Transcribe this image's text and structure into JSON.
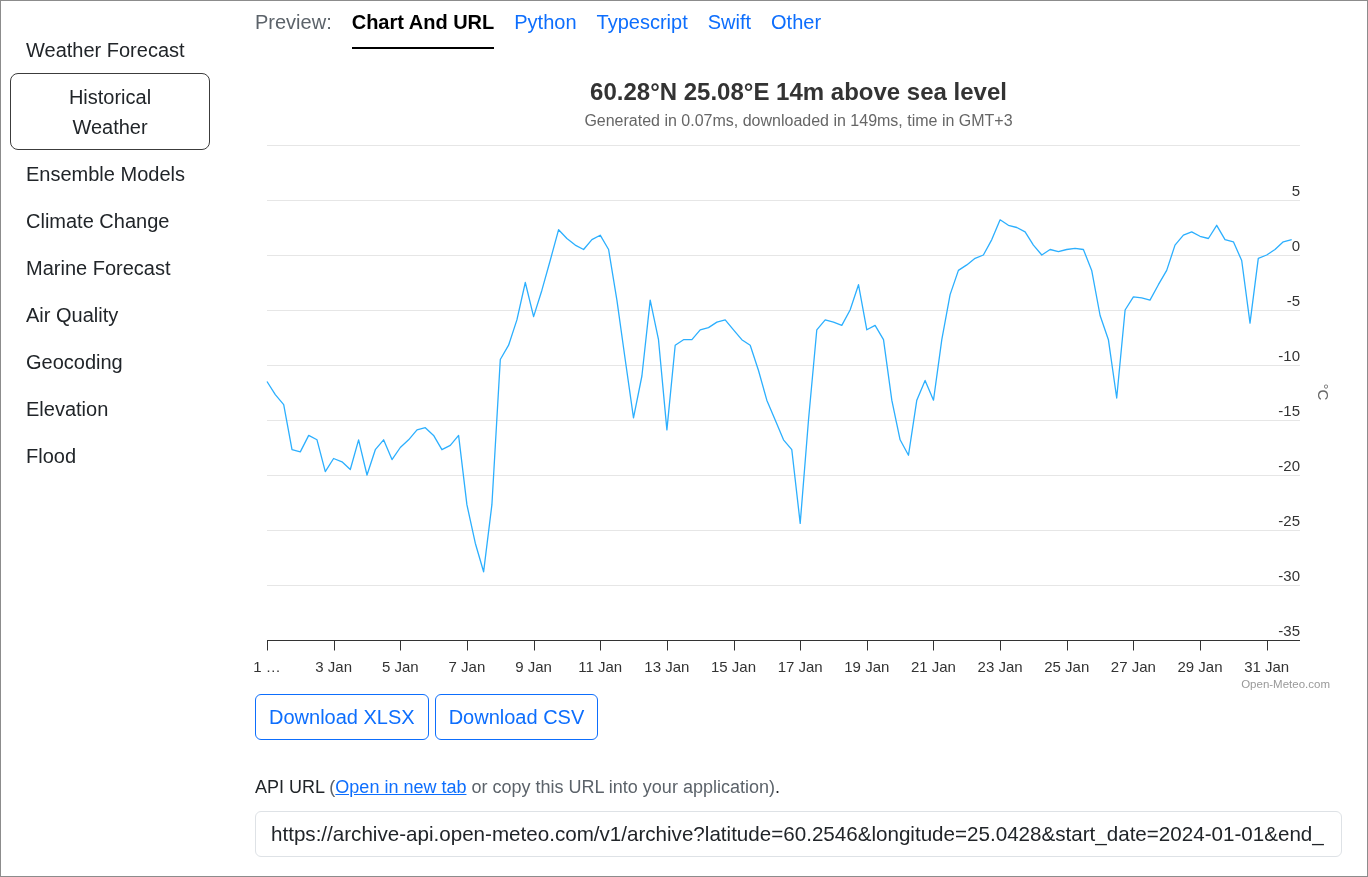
{
  "sidebar": {
    "items": [
      {
        "label": "Weather Forecast",
        "selected": false
      },
      {
        "label": "Historical Weather",
        "selected": true
      },
      {
        "label": "Ensemble Models",
        "selected": false
      },
      {
        "label": "Climate Change",
        "selected": false
      },
      {
        "label": "Marine Forecast",
        "selected": false
      },
      {
        "label": "Air Quality",
        "selected": false
      },
      {
        "label": "Geocoding",
        "selected": false
      },
      {
        "label": "Elevation",
        "selected": false
      },
      {
        "label": "Flood",
        "selected": false
      }
    ]
  },
  "preview_tabs": {
    "label": "Preview:",
    "tabs": [
      {
        "label": "Chart And URL",
        "selected": true
      },
      {
        "label": "Python",
        "selected": false
      },
      {
        "label": "Typescript",
        "selected": false
      },
      {
        "label": "Swift",
        "selected": false
      },
      {
        "label": "Other",
        "selected": false
      }
    ]
  },
  "chart": {
    "subtitle": "Generated in 0.07ms, downloaded in 149ms, time in GMT+3",
    "credit": "Open-Meteo.com",
    "chart_data": {
      "type": "line",
      "title": "60.28°N 25.08°E 14m above sea level",
      "ylabel": "°C",
      "grid": true,
      "categories": [
        "1 …",
        null,
        null,
        null,
        null,
        null,
        null,
        null,
        "3 Jan",
        null,
        null,
        null,
        null,
        null,
        null,
        null,
        "5 Jan",
        null,
        null,
        null,
        null,
        null,
        null,
        null,
        "7 Jan",
        null,
        null,
        null,
        null,
        null,
        null,
        null,
        "9 Jan",
        null,
        null,
        null,
        null,
        null,
        null,
        null,
        "11 Jan",
        null,
        null,
        null,
        null,
        null,
        null,
        null,
        "13 Jan",
        null,
        null,
        null,
        null,
        null,
        null,
        null,
        "15 Jan",
        null,
        null,
        null,
        null,
        null,
        null,
        null,
        "17 Jan",
        null,
        null,
        null,
        null,
        null,
        null,
        null,
        "19 Jan",
        null,
        null,
        null,
        null,
        null,
        null,
        null,
        "21 Jan",
        null,
        null,
        null,
        null,
        null,
        null,
        null,
        "23 Jan",
        null,
        null,
        null,
        null,
        null,
        null,
        null,
        "25 Jan",
        null,
        null,
        null,
        null,
        null,
        null,
        null,
        "27 Jan",
        null,
        null,
        null,
        null,
        null,
        null,
        null,
        "29 Jan",
        null,
        null,
        null,
        null,
        null,
        null,
        null,
        "31 Jan",
        null,
        null,
        null
      ],
      "ylim": [
        -35,
        10
      ],
      "yticks": [
        -35,
        -30,
        -25,
        -20,
        -15,
        -10,
        -5,
        0,
        5
      ],
      "series": [
        {
          "color": "#2caffe",
          "values": [
            -11.5,
            -12.7,
            -13.6,
            -17.7,
            -17.9,
            -16.4,
            -16.8,
            -19.7,
            -18.5,
            -18.8,
            -19.5,
            -16.8,
            -20,
            -17.7,
            -16.8,
            -18.6,
            -17.5,
            -16.8,
            -15.9,
            -15.7,
            -16.4,
            -17.7,
            -17.3,
            -16.4,
            -22.7,
            -26.2,
            -28.8,
            -22.7,
            -9.5,
            -8.2,
            -5.9,
            -2.5,
            -5.6,
            -3.2,
            -0.5,
            2.3,
            1.5,
            0.9,
            0.5,
            1.4,
            1.8,
            0.5,
            -4.1,
            -9.5,
            -14.8,
            -11,
            -4.1,
            -7.7,
            -15.9,
            -8.2,
            -7.7,
            -7.7,
            -6.8,
            -6.6,
            -6.1,
            -5.9,
            -6.8,
            -7.7,
            -8.2,
            -10.5,
            -13.2,
            -15,
            -16.8,
            -17.7,
            -24.4,
            -15,
            -6.8,
            -5.9,
            -6.1,
            -6.4,
            -5,
            -2.7,
            -6.8,
            -6.4,
            -7.7,
            -13.2,
            -16.8,
            -18.2,
            -13.2,
            -11.4,
            -13.2,
            -7.7,
            -3.6,
            -1.4,
            -0.9,
            -0.3,
            0,
            1.4,
            3.2,
            2.7,
            2.5,
            2.1,
            0.9,
            0,
            0.5,
            0.3,
            0.5,
            0.6,
            0.5,
            -1.4,
            -5.5,
            -7.7,
            -13,
            -5,
            -3.8,
            -3.9,
            -4.1,
            -2.7,
            -1.4,
            0.9,
            1.8,
            2.1,
            1.7,
            1.5,
            2.7,
            1.4,
            1.2,
            -0.5,
            -6.2,
            -0.3,
            0,
            0.5,
            1.2,
            1.4
          ]
        }
      ]
    }
  },
  "downloads": [
    "Download XLSX",
    "Download CSV"
  ],
  "api_url": {
    "label": "API URL",
    "open": "(",
    "link": "Open in new tab",
    "rest": "or copy this URL into your application)",
    "end": ".",
    "value": "https://archive-api.open-meteo.com/v1/archive?latitude=60.2546&longitude=25.0428&start_date=2024-01-01&end_"
  }
}
